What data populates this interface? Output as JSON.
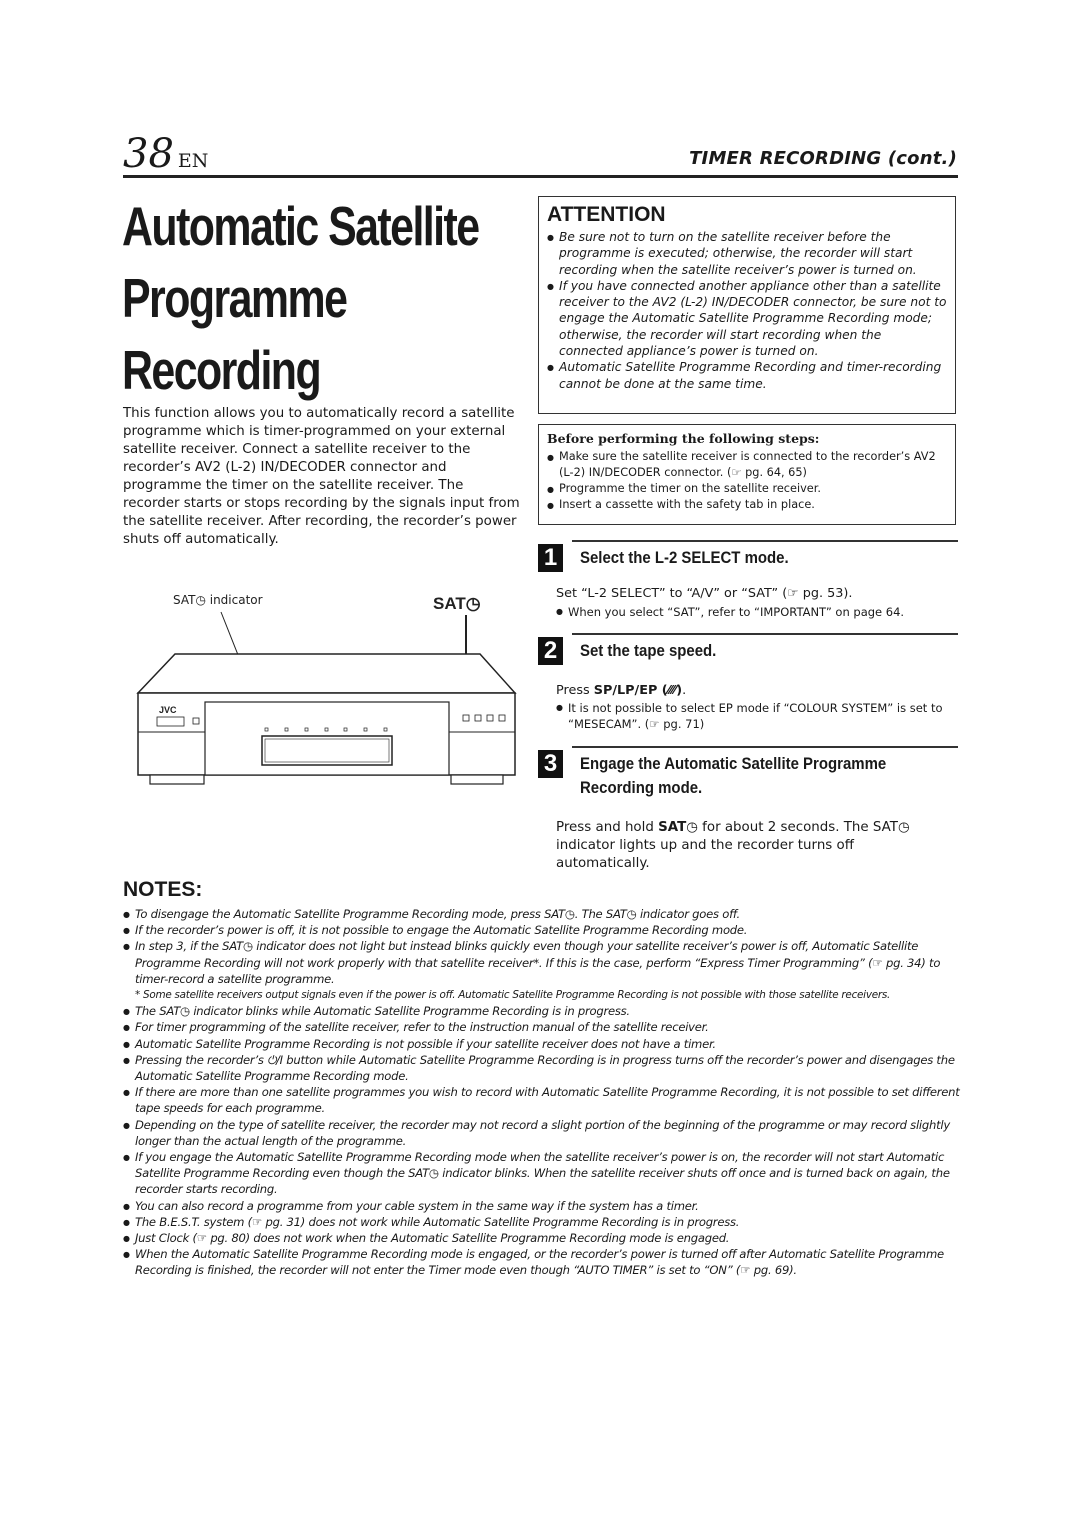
{
  "header": {
    "page_number": "38",
    "language": "EN",
    "section_title": "TIMER RECORDING (cont.)"
  },
  "title": {
    "line1": "Automatic Satellite",
    "line2": "Programme",
    "line3": "Recording"
  },
  "intro": "This function allows you to automatically record a satellite programme which is timer-programmed on your external satellite receiver. Connect a satellite receiver to the recorder’s AV2 (L-2) IN/DECODER connector and programme the timer on the satellite receiver. The recorder starts or stops recording by the signals input from the satellite receiver. After recording, the recorder’s power shuts off automatically.",
  "diagram": {
    "indicator_label": "SAT◷ indicator",
    "button_label": "SAT◷",
    "brand": "JVC"
  },
  "attention": {
    "heading": "ATTENTION",
    "items": [
      "Be sure not to turn on the satellite receiver before the programme is executed; otherwise, the recorder will start recording when the satellite receiver’s power is turned on.",
      "If you have connected another appliance other than a satellite receiver to the AV2 (L-2) IN/DECODER connector, be sure not to engage the Automatic Satellite Programme Recording mode; otherwise, the recorder will start recording when the connected appliance’s power is turned on.",
      "Automatic Satellite Programme Recording and timer-recording cannot be done at the same time."
    ]
  },
  "before": {
    "heading": "Before performing the following steps:",
    "items": [
      "Make sure the satellite receiver is connected to the recorder’s AV2 (L-2) IN/DECODER connector. (☞ pg. 64, 65)",
      "Programme the timer on the satellite receiver.",
      "Insert a cassette with the safety tab in place."
    ]
  },
  "steps": [
    {
      "number": "1",
      "title": "Select the L-2 SELECT mode.",
      "body": "Set  “L-2 SELECT” to “A/V” or “SAT” (☞ pg. 53).",
      "note": "When you select “SAT”, refer to “IMPORTANT” on page 64."
    },
    {
      "number": "2",
      "title": "Set the tape speed.",
      "body_prefix": "Press ",
      "body_bold": "SP/LP/EP (⁄⁄⁄⁄)",
      "body_suffix": ".",
      "note": "It is not possible to select EP mode if “COLOUR SYSTEM” is set to “MESECAM”. (☞ pg. 71)"
    },
    {
      "number": "3",
      "title_line1": "Engage the Automatic Satellite Programme",
      "title_line2": "Recording mode.",
      "body_p1": "Press and hold ",
      "body_bold": "SAT◷",
      "body_p2": " for about 2 seconds. The SAT◷ indicator lights up and the recorder turns off automatically."
    }
  ],
  "notes": {
    "heading": "NOTES:",
    "items": [
      "To disengage the Automatic Satellite Programme Recording mode, press SAT◷. The SAT◷ indicator goes off.",
      "If the recorder’s power is off, it is not possible to engage the Automatic Satellite Programme Recording mode.",
      "In step 3, if the SAT◷ indicator does not light but instead blinks quickly even though your satellite receiver’s power is off, Automatic Satellite Programme Recording will not work properly with that satellite receiver*. If this is the case, perform “Express Timer Programming” (☞ pg. 34) to timer-record a satellite programme.",
      "* Some satellite receivers output signals even if the power is off. Automatic Satellite Programme Recording is not possible with those satellite receivers.",
      "The SAT◷ indicator blinks while Automatic Satellite Programme Recording is in progress.",
      "For timer programming of the satellite receiver, refer to the instruction manual of the satellite receiver.",
      "Automatic Satellite Programme Recording is not possible if your satellite receiver does not have a timer.",
      "Pressing the recorder’s ⏻/I button while Automatic Satellite Programme Recording is in progress turns off the recorder’s power and disengages the Automatic Satellite Programme Recording mode.",
      "If there are more than one satellite programmes you wish to record with Automatic Satellite Programme Recording, it is not possible to set different tape speeds for each programme.",
      "Depending on the type of satellite receiver, the recorder may not record a slight portion of the beginning of the programme or may record slightly longer than the actual length of the programme.",
      "If you engage the Automatic Satellite Programme Recording mode when the satellite receiver’s power is on, the recorder will not start Automatic Satellite Programme Recording even though the SAT◷ indicator blinks. When the satellite receiver shuts off once and is turned back on again, the recorder starts recording.",
      "You can also record a programme from your cable system in the same way if the system has a timer.",
      "The B.E.S.T. system (☞ pg. 31) does not work while Automatic Satellite Programme Recording is in progress.",
      "Just Clock (☞ pg. 80) does not work when the Automatic Satellite Programme Recording mode is engaged.",
      "When the Automatic Satellite Programme Recording mode is engaged, or the recorder’s power is turned off after Automatic Satellite Programme Recording is finished, the recorder will not enter the Timer mode even though “AUTO TIMER” is set to “ON” (☞ pg. 69)."
    ]
  }
}
